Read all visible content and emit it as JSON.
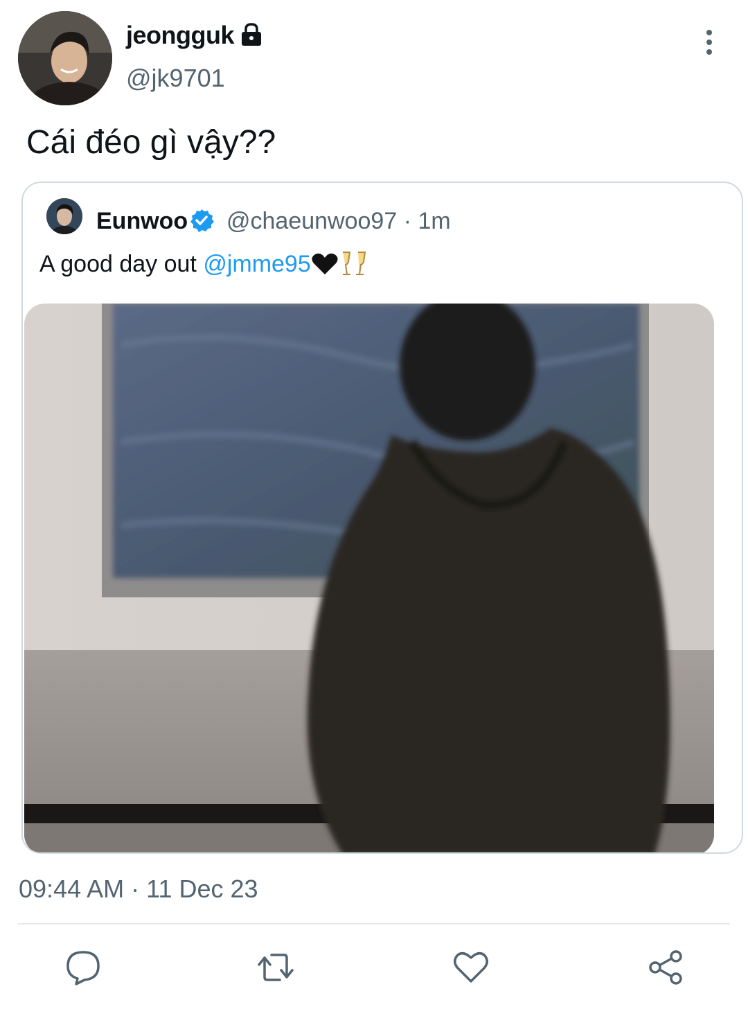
{
  "tweet": {
    "author": {
      "display_name": "jeongguk",
      "handle": "@jk9701",
      "avatar_icon": "profile-photo",
      "protected_icon": "lock-icon"
    },
    "text": "Cái đéo gì vậy??",
    "timestamp": "09:44 AM · 11 Dec 23"
  },
  "quoted_tweet": {
    "author": {
      "display_name": "Eunwoo",
      "handle_time": "@chaeunwoo97 · 1m",
      "verified_icon": "verified-badge-icon"
    },
    "text_prefix": "A good day out ",
    "mention": "@jmme95",
    "emojis": [
      "black-heart-emoji",
      "clinking-glasses-emoji"
    ]
  },
  "actions": [
    {
      "name": "reply",
      "icon": "reply-icon"
    },
    {
      "name": "retweet",
      "icon": "retweet-icon"
    },
    {
      "name": "like",
      "icon": "heart-icon"
    },
    {
      "name": "share",
      "icon": "share-icon"
    }
  ],
  "colors": {
    "accent": "#1d9bf0",
    "secondary_text": "#536471",
    "border": "#cfd9de",
    "icon": "#536471"
  }
}
